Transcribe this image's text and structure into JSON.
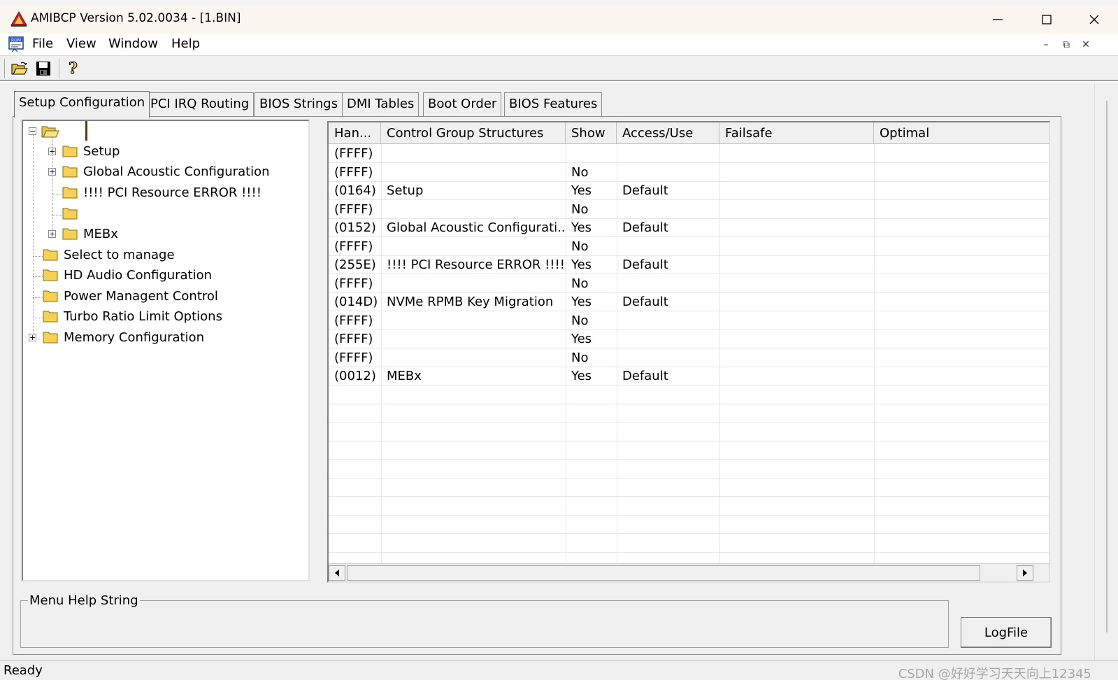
{
  "window": {
    "title": "AMIBCP Version 5.02.0034 - [1.BIN]"
  },
  "menu": {
    "items": [
      "File",
      "View",
      "Window",
      "Help"
    ]
  },
  "tabs": [
    "Setup Configuration",
    "PCI IRQ Routing",
    "BIOS Strings",
    "DMI Tables",
    "Boot Order",
    "BIOS Features"
  ],
  "tree": {
    "items": [
      {
        "label": "Setup"
      },
      {
        "label": "Global Acoustic Configuration"
      },
      {
        "label": "!!!! PCI Resource ERROR !!!!"
      },
      {
        "label": ""
      },
      {
        "label": "MEBx"
      },
      {
        "label": "Select to manage"
      },
      {
        "label": "HD Audio Configuration"
      },
      {
        "label": "Power Managent Control"
      },
      {
        "label": "Turbo Ratio Limit Options"
      },
      {
        "label": "Memory Configuration"
      }
    ]
  },
  "grid": {
    "columns": [
      "Han...",
      "Control Group Structures",
      "Show",
      "Access/Use",
      "Failsafe",
      "Optimal"
    ],
    "rows": [
      [
        "(FFFF)",
        "",
        "",
        "",
        "",
        ""
      ],
      [
        "(FFFF)",
        "",
        "No",
        "",
        "",
        ""
      ],
      [
        "(0164)",
        "Setup",
        "Yes",
        "Default",
        "",
        ""
      ],
      [
        "(FFFF)",
        "",
        "No",
        "",
        "",
        ""
      ],
      [
        "(0152)",
        "Global Acoustic Configurati...",
        "Yes",
        "Default",
        "",
        ""
      ],
      [
        "(FFFF)",
        "",
        "No",
        "",
        "",
        ""
      ],
      [
        "(255E)",
        "!!!! PCI Resource ERROR !!!!",
        "Yes",
        "Default",
        "",
        ""
      ],
      [
        "(FFFF)",
        "",
        "No",
        "",
        "",
        ""
      ],
      [
        "(014D)",
        "NVMe RPMB Key Migration",
        "Yes",
        "Default",
        "",
        ""
      ],
      [
        "(FFFF)",
        "",
        "No",
        "",
        "",
        ""
      ],
      [
        "(FFFF)",
        "",
        "Yes",
        "",
        "",
        ""
      ],
      [
        "(FFFF)",
        "",
        "No",
        "",
        "",
        ""
      ],
      [
        "(0012)",
        "MEBx",
        "Yes",
        "Default",
        "",
        ""
      ]
    ]
  },
  "help": {
    "group_label": "Menu Help String",
    "logfile_button": "LogFile"
  },
  "status": {
    "text": "Ready"
  },
  "watermark": "CSDN @好好学习天天向上12345",
  "colors": {
    "titlebar_bg": "#fbf6f0",
    "workspace_bg": "#f0f0f0",
    "folder_yellow": "#f6d155"
  }
}
